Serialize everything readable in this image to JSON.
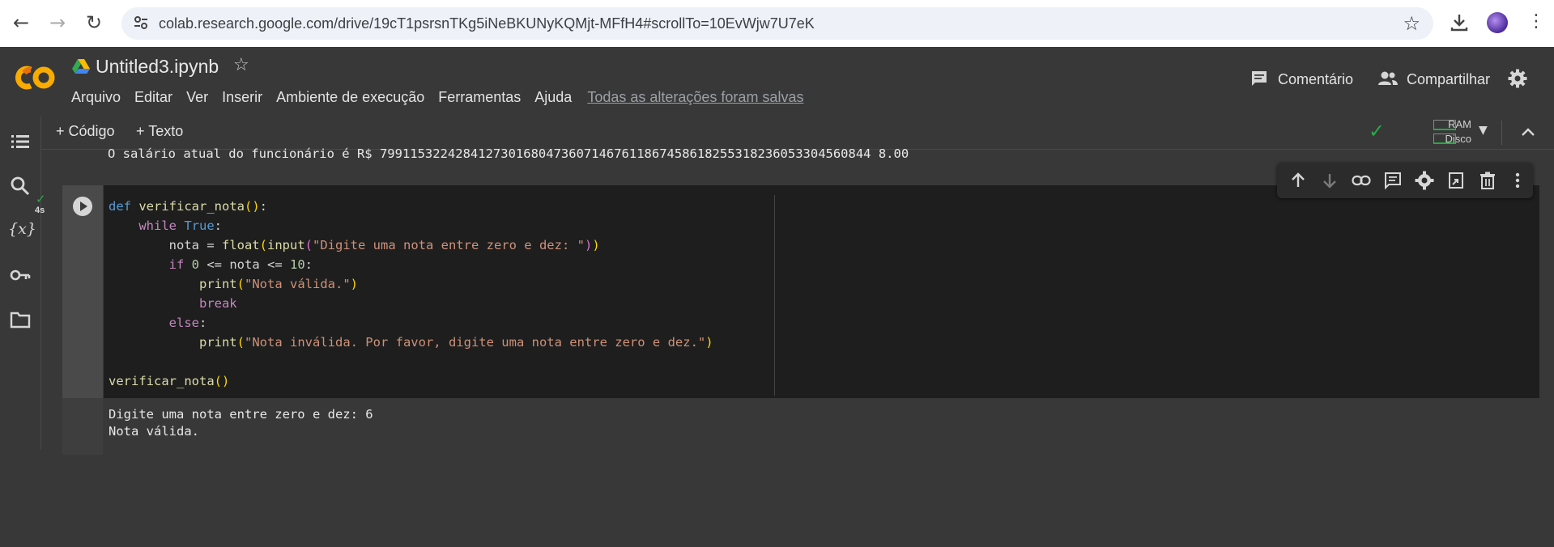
{
  "browser": {
    "url": "colab.research.google.com/drive/19cT1psrsnTKg5iNeBKUNyKQMjt-MFfH4#scrollTo=10EvWjw7U7eK"
  },
  "header": {
    "title": "Untitled3.ipynb",
    "menu": [
      "Arquivo",
      "Editar",
      "Ver",
      "Inserir",
      "Ambiente de execução",
      "Ferramentas",
      "Ajuda"
    ],
    "save_status": "Todas as alterações foram salvas",
    "comment_label": "Comentário",
    "share_label": "Compartilhar"
  },
  "toolbar": {
    "add_code": "+ Código",
    "add_text": "+ Texto",
    "ram_label": "RAM",
    "disk_label": "Disco"
  },
  "notebook": {
    "previous_output": "O salário atual do funcionário é R$ 79911532242841273016804736071467611867458618255318236053304560844 8.00",
    "cell": {
      "exec_time": "4s",
      "code_lines": [
        "def verificar_nota():",
        "    while True:",
        "        nota = float(input(\"Digite uma nota entre zero e dez: \"))",
        "        if 0 <= nota <= 10:",
        "            print(\"Nota válida.\")",
        "            break",
        "        else:",
        "            print(\"Nota inválida. Por favor, digite uma nota entre zero e dez.\")",
        "",
        "verificar_nota()"
      ],
      "output_lines": [
        "Digite uma nota entre zero e dez: 6",
        "Nota válida."
      ]
    }
  },
  "icons": {
    "sidebar": [
      "table-of-contents-icon",
      "search-icon",
      "variables-icon",
      "secrets-key-icon",
      "files-folder-icon"
    ],
    "cell_toolbar": [
      "move-up-icon",
      "move-down-icon",
      "link-icon",
      "comment-icon",
      "settings-icon",
      "mirror-tab-icon",
      "delete-icon",
      "more-icon"
    ]
  },
  "colors": {
    "accent_orange": "#f9ab00",
    "status_green": "#2aa84a"
  }
}
